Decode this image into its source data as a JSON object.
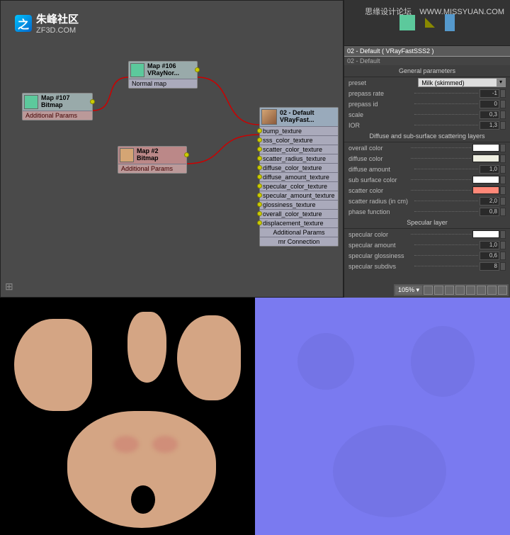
{
  "watermark": {
    "label": "思缘设计论坛",
    "url": "WWW.MISSYUAN.COM"
  },
  "logo": {
    "glyph": "之",
    "title": "朱峰社区",
    "sub": "ZF3D.COM"
  },
  "nodes": {
    "bitmap": {
      "name": "Map #107",
      "type": "Bitmap",
      "footer": "Additional Params"
    },
    "normal": {
      "name": "Map #106",
      "type": "VRayNor...",
      "slot": "Normal map"
    },
    "bitmap2": {
      "name": "Map #2",
      "type": "Bitmap",
      "footer": "Additional Params"
    },
    "material": {
      "name": "02 - Default",
      "type": "VRayFast...",
      "slots": [
        "bump_texture",
        "sss_color_texture",
        "scatter_color_texture",
        "scatter_radius_texture",
        "diffuse_color_texture",
        "diffuse_amount_texture",
        "specular_color_texture",
        "specular_amount_texture",
        "glossiness_texture",
        "overall_color_texture",
        "displacement_texture"
      ],
      "footer1": "Additional Params",
      "footer2": "mr Connection"
    }
  },
  "panel": {
    "header": "02 - Default  ( VRayFastSSS2 )",
    "sub": "02 - Default",
    "rollups": {
      "general": {
        "title": "General parameters",
        "preset_label": "preset",
        "preset_value": "Milk (skimmed)",
        "rows": [
          {
            "label": "prepass rate",
            "value": "-1"
          },
          {
            "label": "prepass id",
            "value": "0"
          },
          {
            "label": "scale",
            "value": "0,3"
          },
          {
            "label": "IOR",
            "value": "1,3"
          }
        ]
      },
      "diffuse": {
        "title": "Diffuse and sub-surface scattering layers",
        "rows": [
          {
            "label": "overall color",
            "swatch": "#ffffff"
          },
          {
            "label": "diffuse color",
            "swatch": "#eeeee0"
          },
          {
            "label": "diffuse amount",
            "value": "1,0"
          },
          {
            "label": "sub surface color",
            "swatch": "#ffffff"
          },
          {
            "label": "scatter color",
            "swatch": "#ff8878"
          },
          {
            "label": "scatter radius (in cm)",
            "value": "2,0"
          },
          {
            "label": "phase function",
            "value": "0,8"
          }
        ]
      },
      "specular": {
        "title": "Specular layer",
        "rows": [
          {
            "label": "specular color",
            "swatch": "#ffffff"
          },
          {
            "label": "specular amount",
            "value": "1,0"
          },
          {
            "label": "specular glossiness",
            "value": "0,6"
          },
          {
            "label": "specular subdivs",
            "value": "8"
          }
        ]
      }
    }
  },
  "zoom": {
    "pct": "105%"
  }
}
